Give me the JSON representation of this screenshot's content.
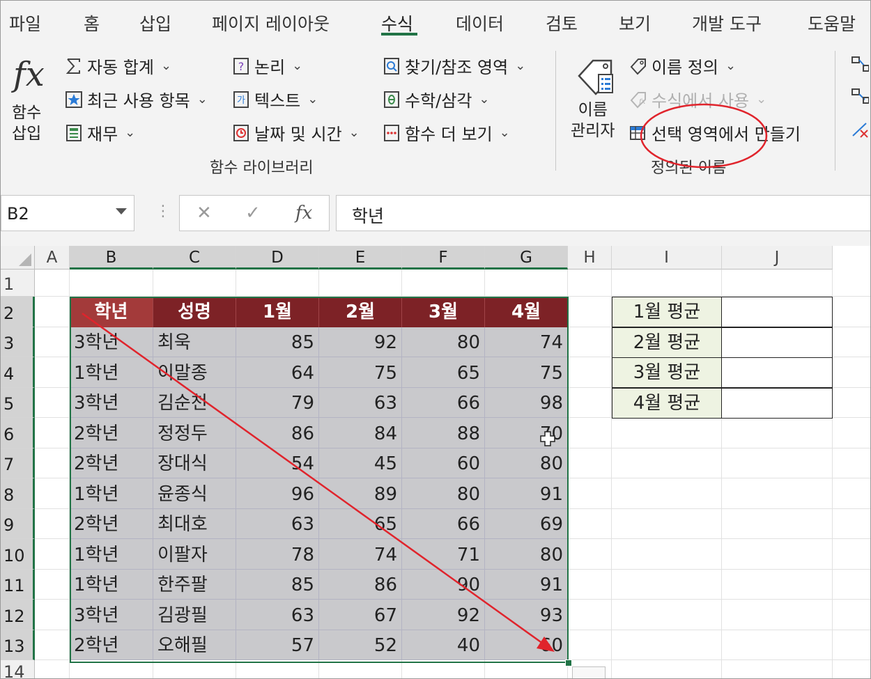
{
  "ribbon": {
    "tabs": [
      "파일",
      "홈",
      "삽입",
      "페이지 레이아웃",
      "수식",
      "데이터",
      "검토",
      "보기",
      "개발 도구",
      "도움말"
    ],
    "active_tab": "수식",
    "insert_function": {
      "glyph": "fx",
      "line1": "함수",
      "line2": "삽입"
    },
    "library": {
      "autosum": "자동 합계",
      "recent": "최근 사용 항목",
      "financial": "재무",
      "logical": "논리",
      "text": "텍스트",
      "datetime": "날짜 및 시간",
      "lookup": "찾기/참조 영역",
      "math": "수학/삼각",
      "more": "함수 더 보기",
      "group_label": "함수 라이브러리"
    },
    "names": {
      "manager_line1": "이름",
      "manager_line2": "관리자",
      "define_name": "이름 정의",
      "use_in_formula": "수식에서 사용",
      "create_from_selection": "선택 영역에서 만들기",
      "group_label": "정의된 이름"
    }
  },
  "formula_bar": {
    "name_box": "B2",
    "cancel": "✕",
    "enter": "✓",
    "fx": "fx",
    "content": "학년"
  },
  "sheet": {
    "columns": [
      "A",
      "B",
      "C",
      "D",
      "E",
      "F",
      "G",
      "H",
      "I",
      "J"
    ],
    "rows": [
      "1",
      "2",
      "3",
      "4",
      "5",
      "6",
      "7",
      "8",
      "9",
      "10",
      "11",
      "12",
      "13",
      "14"
    ],
    "headers": [
      "학년",
      "성명",
      "1월",
      "2월",
      "3월",
      "4월"
    ],
    "data": [
      [
        "3학년",
        "최욱",
        "85",
        "92",
        "80",
        "74"
      ],
      [
        "1학년",
        "이말종",
        "64",
        "75",
        "65",
        "75"
      ],
      [
        "3학년",
        "김순천",
        "79",
        "63",
        "66",
        "98"
      ],
      [
        "2학년",
        "정정두",
        "86",
        "84",
        "88",
        "70"
      ],
      [
        "2학년",
        "장대식",
        "54",
        "45",
        "60",
        "80"
      ],
      [
        "1학년",
        "윤종식",
        "96",
        "89",
        "80",
        "91"
      ],
      [
        "2학년",
        "최대호",
        "63",
        "65",
        "66",
        "69"
      ],
      [
        "1학년",
        "이팔자",
        "78",
        "74",
        "71",
        "80"
      ],
      [
        "1학년",
        "한주팔",
        "85",
        "86",
        "90",
        "91"
      ],
      [
        "3학년",
        "김광필",
        "63",
        "67",
        "92",
        "93"
      ],
      [
        "2학년",
        "오해필",
        "57",
        "52",
        "40",
        "60"
      ]
    ],
    "averages": [
      "1월 평균",
      "2월 평균",
      "3월 평균",
      "4월 평균"
    ]
  },
  "colors": {
    "accent": "#217346",
    "header_fill": "#7d2226",
    "data_fill": "#c9c9cc",
    "annotation": "#e0242c"
  }
}
